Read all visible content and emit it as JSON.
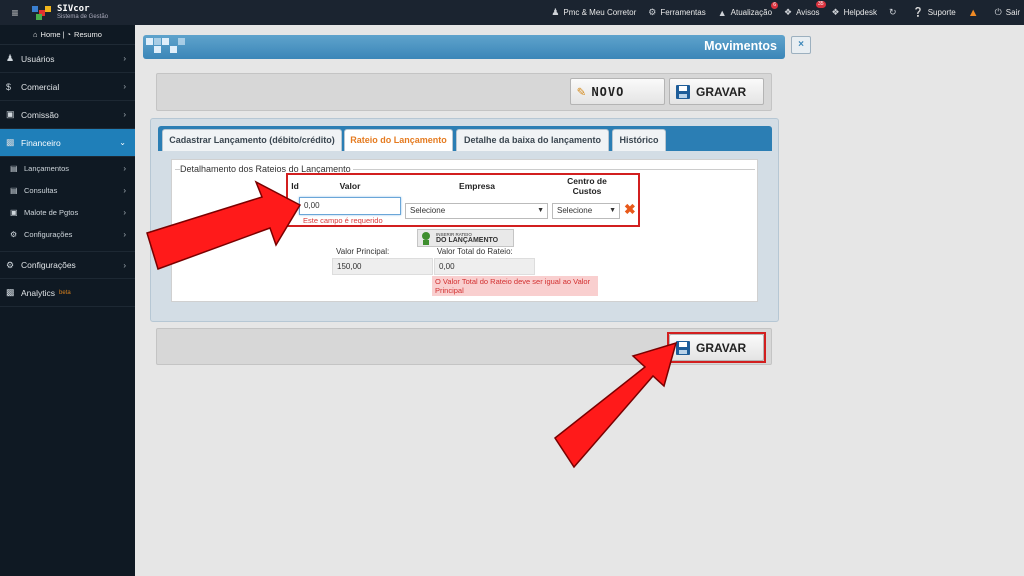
{
  "topbar": {
    "brand": "SIVcor",
    "brand_sub": "Sistema de Gestão",
    "items": [
      {
        "label": "Pmc & Meu Corretor",
        "icon": "user-icon",
        "badge": ""
      },
      {
        "label": "Ferramentas",
        "icon": "cogs-icon",
        "badge": ""
      },
      {
        "label": "Atualização",
        "icon": "warning-icon",
        "badge": "6"
      },
      {
        "label": "Avisos",
        "icon": "comments-icon",
        "badge": "35"
      },
      {
        "label": "Helpdesk",
        "icon": "chat-icon",
        "badge": ""
      },
      {
        "label": "",
        "icon": "refresh-icon",
        "badge": ""
      },
      {
        "label": "Suporte",
        "icon": "question-icon",
        "badge": ""
      },
      {
        "label": "",
        "icon": "alert-icon",
        "badge": ""
      },
      {
        "label": "Sair",
        "icon": "power-icon",
        "badge": ""
      }
    ]
  },
  "sidebar": {
    "home": "Home",
    "resumo": "Resumo",
    "items": [
      {
        "label": "Usuários",
        "icon": "users-icon"
      },
      {
        "label": "Comercial",
        "icon": "dollar-icon"
      },
      {
        "label": "Comissão",
        "icon": "money-icon"
      },
      {
        "label": "Financeiro",
        "icon": "bank-icon",
        "active": true
      }
    ],
    "subitems": [
      {
        "label": "Lançamentos",
        "icon": "file-icon"
      },
      {
        "label": "Consultas",
        "icon": "folder-icon"
      },
      {
        "label": "Malote de Pgtos",
        "icon": "briefcase-icon"
      },
      {
        "label": "Configurações",
        "icon": "gear-icon"
      }
    ],
    "bottom": [
      {
        "label": "Configurações",
        "icon": "cogs-icon"
      },
      {
        "label": "Analytics",
        "icon": "chart-icon",
        "tag": "beta"
      }
    ]
  },
  "page": {
    "title": "Movimentos",
    "close": "×",
    "novo_label": "NOVO",
    "gravar_label": "GRAVAR"
  },
  "tabs": [
    {
      "label": "Cadastrar Lançamento (débito/crédito)",
      "active": false
    },
    {
      "label": "Rateio do Lançamento",
      "active": true
    },
    {
      "label": "Detalhe da baixa do lançamento",
      "active": false
    },
    {
      "label": "Histórico",
      "active": false
    }
  ],
  "rateio": {
    "legend": "Detalhamento dos Rateios do Lançamento",
    "headers": {
      "id": "Id",
      "valor": "Valor",
      "empresa": "Empresa",
      "centro": "Centro de Custos"
    },
    "valor_value": "0,00",
    "valor_error": "Este campo é requerido",
    "empresa_selected": "Selecione",
    "centro_selected": "Selecione",
    "inserir_line1": "INSERIR RATEIO",
    "inserir_line2": "DO LANÇAMENTO",
    "valor_principal_label": "Valor Principal:",
    "valor_principal_value": "150,00",
    "valor_total_label": "Valor Total do Rateio:",
    "valor_total_value": "0,00",
    "total_error": "O Valor Total do Rateio deve ser igual ao Valor Principal"
  },
  "colors": {
    "accent": "#2b7eb4",
    "active_tab": "#e57b20",
    "highlight": "#d21f1f",
    "sidebar_active": "#1f7fb9"
  }
}
